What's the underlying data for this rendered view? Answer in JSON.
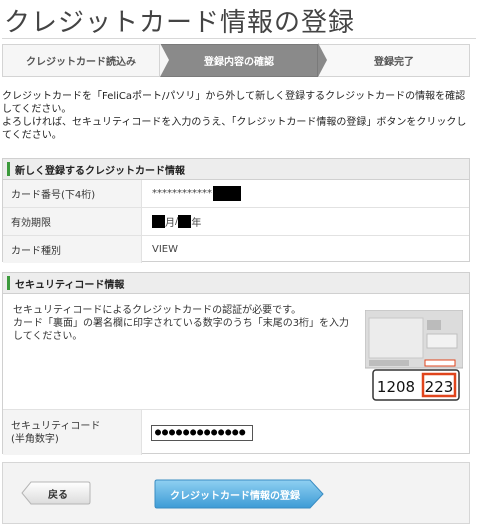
{
  "page": {
    "title": "クレジットカード情報の登録"
  },
  "steps": [
    {
      "label": "クレジットカード読込み",
      "state": "done"
    },
    {
      "label": "登録内容の確認",
      "state": "current"
    },
    {
      "label": "登録完了",
      "state": "upcoming"
    }
  ],
  "intro": {
    "line1": "クレジットカードを「FeliCaポート/パソリ」から外して新しく登録するクレジットカードの情報を確認してください。",
    "line2": "よろしければ、セキュリティコードを入力のうえ、「クレジットカード情報の登録」ボタンをクリックしてください。"
  },
  "card_section": {
    "heading": "新しく登録するクレジットカード情報",
    "rows": [
      {
        "label": "カード番号(下4桁)",
        "value": "************"
      },
      {
        "label": "有効期限",
        "month_unit": "月",
        "slash": "/",
        "year_unit": "年"
      },
      {
        "label": "カード種別",
        "value": "VIEW"
      }
    ]
  },
  "security_section": {
    "heading": "セキュリティコード情報",
    "description1": "セキュリティコードによるクレジットカードの認証が必要です。",
    "description2": "カード「裏面」の署名欄に印字されている数字のうち「末尾の3桁」を入力してください。",
    "card_example": {
      "digits_a": "1208",
      "digits_b": "223"
    },
    "input_label_line1": "セキュリティコード",
    "input_label_line2": "(半角数字)",
    "input_value": "●●●●●●●●●●●●●"
  },
  "footer": {
    "back_label": "戻る",
    "register_label": "クレジットカード情報の登録"
  },
  "colors": {
    "accent_green": "#3c9a3c",
    "step_current": "#8a8a8a",
    "register_button": "#5aaee0",
    "example_highlight": "#e0441c"
  }
}
